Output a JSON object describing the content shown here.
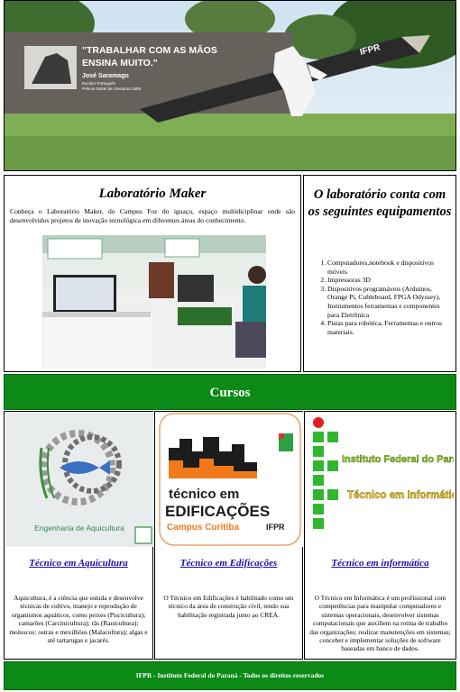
{
  "hero": {
    "quote": "\"TRABALHAR COM AS MÃOS ENSINA MUITO.\"",
    "author": "José Saramago",
    "author_line2": "Escritor Português",
    "author_line3": "Prêmio Nobel de Literatura 1998",
    "pencil_text": "IFPR"
  },
  "about": {
    "title": "Laboratório Maker",
    "text": "Conheça o Laboratório Maker, do Campus Foz do iguaçu, espaço multidiciplinar onde são desenvolvidos projetos de inovação tecnológica em diferentes áreas do conhecimento."
  },
  "equipment": {
    "title": "O laboratório conta com os seguintes equipamentos",
    "items": [
      "Computadores,notebook e dispositivos móveis",
      "Impressoras 3D",
      "Dispositivos programáveis (Arduinos, Orange Pi, Cubleboard, FPGA Odyssey), Instrumentos ferramentas e componentes para Eletrônica",
      "Pistas para robótica, Ferramentas e outros materiais."
    ]
  },
  "cursos": {
    "title": "Cursos"
  },
  "courses": [
    {
      "link": "Técnico em Aquicultura",
      "text": "Aquicultura, é a ciência que estuda e desenvolve técnicas de cultivo, manejo e reprodução de organismos aquáticos, como peixes (Piscicultura); camarões (Carcinicultura); rãs (Ranicultura); moluscos: ostras e mexilhões (Malacultura); algas e até tartarugas e jacarés.",
      "image_caption": "Engenharia de Aquicultura"
    },
    {
      "link": "Técnico em Edificações",
      "text": "O Técnico em Edificações é habilitado como um técnico da área de construção civil, tendo sua habilitação registrada junto ao CREA.",
      "image_line1": "técnico em",
      "image_line2": "EDIFICAÇÕES",
      "image_line3": "Campus Curitiba",
      "image_line4": "IFPR"
    },
    {
      "link": "Técnico em informática",
      "text": "O Técnico em Informática é um profissional com competências para manipular computadores e sistemas operacionais, desenvolver sistemas computacionais que auxiliem na rotina de trabalho das organizações; realizar manutenções em sistemas; conceber e implementar soluções de software baseadas em banco de dados.",
      "image_line1": "Instituto Federal do Paraná",
      "image_line2": "Técnico em Informática"
    }
  ],
  "footer": {
    "text": "IFPR - Instituto Federal do Paraná - Todos os direitos reservados"
  },
  "colors": {
    "green": "#0c8a17",
    "link": "#1a0dab"
  }
}
